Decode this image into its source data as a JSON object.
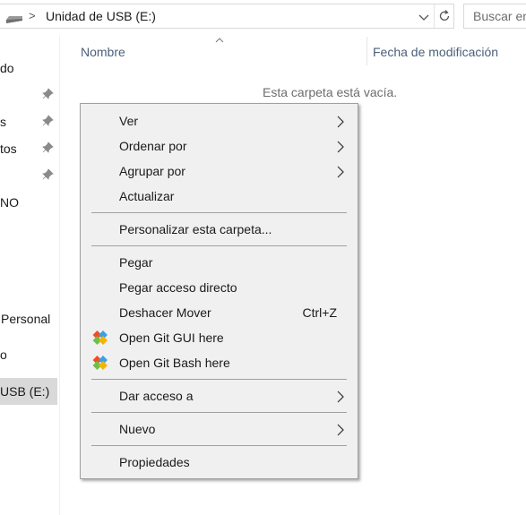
{
  "address_bar": {
    "path_separator": ">",
    "path": "Unidad de USB (E:)",
    "drive_icon": "usb-drive-icon",
    "dropdown_icon": "chevron-down-icon",
    "refresh_icon": "refresh-icon"
  },
  "search": {
    "placeholder": "Buscar en"
  },
  "nav_pane": {
    "items": [
      {
        "label": "do",
        "pinned": false
      },
      {
        "label": "",
        "pinned": true
      },
      {
        "label": "s",
        "pinned": true
      },
      {
        "label": "tos",
        "pinned": true
      },
      {
        "label": "",
        "pinned": true
      },
      {
        "label": "NO",
        "pinned": false
      },
      {
        "label": "Personal",
        "pinned": false
      },
      {
        "label": "o",
        "pinned": false
      },
      {
        "label": "USB (E:)",
        "pinned": false,
        "selected": true
      }
    ]
  },
  "columns": {
    "name": "Nombre",
    "date_modified": "Fecha de modificación",
    "sort_icon": "sort-up-icon"
  },
  "empty_message": "Esta carpeta está vacía.",
  "context_menu": {
    "group1": [
      {
        "label": "Ver",
        "submenu": true
      },
      {
        "label": "Ordenar por",
        "submenu": true
      },
      {
        "label": "Agrupar por",
        "submenu": true
      },
      {
        "label": "Actualizar",
        "submenu": false
      }
    ],
    "group2": [
      {
        "label": "Personalizar esta carpeta..."
      }
    ],
    "group3": [
      {
        "label": "Pegar"
      },
      {
        "label": "Pegar acceso directo"
      },
      {
        "label": "Deshacer Mover",
        "shortcut": "Ctrl+Z"
      },
      {
        "label": "Open Git GUI here",
        "icon": "git-gui-icon"
      },
      {
        "label": "Open Git Bash here",
        "icon": "git-bash-icon"
      }
    ],
    "group4": [
      {
        "label": "Dar acceso a",
        "submenu": true
      }
    ],
    "group5": [
      {
        "label": "Nuevo",
        "submenu": true
      }
    ],
    "group6": [
      {
        "label": "Propiedades"
      }
    ]
  },
  "colors": {
    "menu_bg": "#f0f0f0",
    "menu_border": "#a0a0a0",
    "header_text": "#4c607a",
    "selected_bg": "#d9d9d9",
    "muted_text": "#6d6d6d"
  }
}
